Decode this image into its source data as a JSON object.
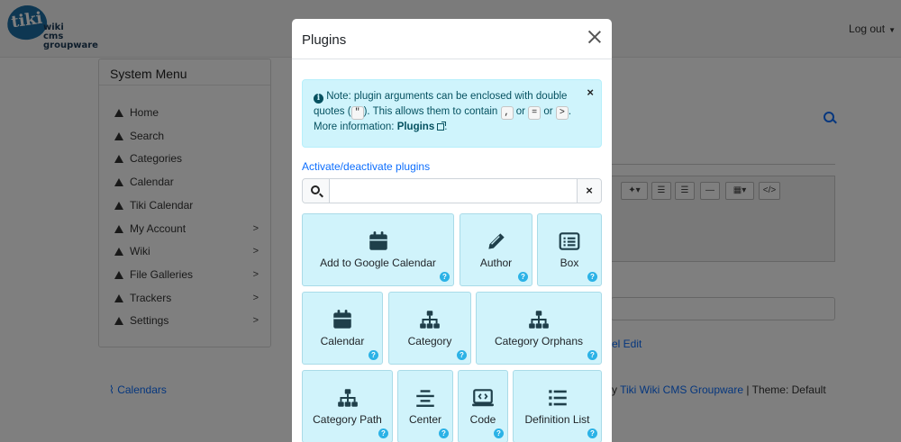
{
  "header": {
    "logo_main": "tiki",
    "logo_sub_1": "wiki",
    "logo_sub_2": "cms",
    "logo_sub_3": "groupware",
    "logout_label": "Log out"
  },
  "system_menu": {
    "title": "System Menu",
    "items": [
      {
        "label": "Home",
        "has_submenu": false
      },
      {
        "label": "Search",
        "has_submenu": false
      },
      {
        "label": "Categories",
        "has_submenu": false
      },
      {
        "label": "Calendar",
        "has_submenu": false
      },
      {
        "label": "Tiki Calendar",
        "has_submenu": false
      },
      {
        "label": "My Account",
        "has_submenu": true
      },
      {
        "label": "Wiki",
        "has_submenu": true
      },
      {
        "label": "File Galleries",
        "has_submenu": true
      },
      {
        "label": "Trackers",
        "has_submenu": true
      },
      {
        "label": "Settings",
        "has_submenu": true
      }
    ]
  },
  "background": {
    "calendars_link": "Calendars",
    "el_edit_link": "el Edit",
    "footer_prefix": "y",
    "footer_link": "Tiki Wiki CMS Groupware",
    "footer_theme": "| Theme: Default"
  },
  "modal": {
    "title": "Plugins",
    "alert": {
      "part1": "Note: plugin arguments can be enclosed with double quotes (",
      "key_quote": "\"",
      "part2": "). This allows them to contain",
      "key_comma": ",",
      "part3": "or",
      "key_equals": "=",
      "part4": "or",
      "key_gt": ">",
      "part5": ". More information:",
      "link": "Plugins"
    },
    "activate_link": "Activate/deactivate plugins",
    "search": {
      "value": "",
      "placeholder": ""
    },
    "plugins": [
      {
        "label": "Add to Google Calendar",
        "icon": "calendar-icon"
      },
      {
        "label": "Author",
        "icon": "pencil-icon"
      },
      {
        "label": "Box",
        "icon": "list-box-icon"
      },
      {
        "label": "Calendar",
        "icon": "calendar-icon"
      },
      {
        "label": "Category",
        "icon": "sitemap-icon"
      },
      {
        "label": "Category Orphans",
        "icon": "sitemap-icon"
      },
      {
        "label": "Category Path",
        "icon": "sitemap-icon"
      },
      {
        "label": "Center",
        "icon": "align-center-icon"
      },
      {
        "label": "Code",
        "icon": "code-icon"
      },
      {
        "label": "Definition List",
        "icon": "list-icon"
      }
    ],
    "help_glyph": "?"
  },
  "colors": {
    "plugin_bg": "#d0f3fb",
    "alert_bg": "#cff4fc",
    "link": "#0d6efd",
    "help_dot": "#2bb2e6"
  }
}
